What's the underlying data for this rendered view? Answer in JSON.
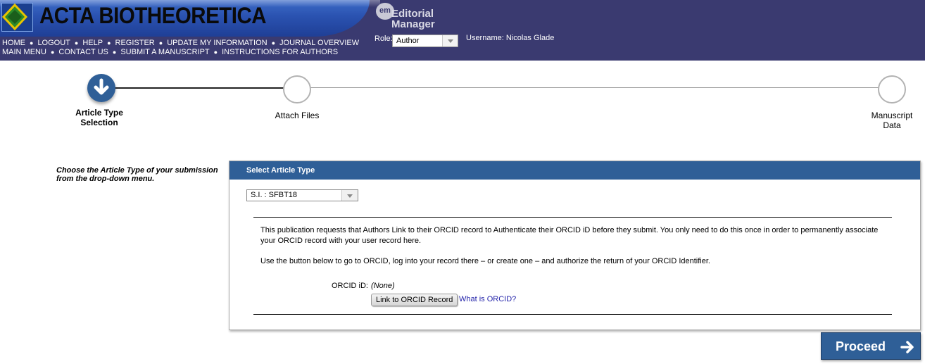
{
  "header": {
    "journal_title": "ACTA BIOTHEORETICA",
    "em_badge": "em",
    "em_line1": "Editorial",
    "em_line2": "Manager",
    "nav_row1": [
      "HOME",
      "LOGOUT",
      "HELP",
      "REGISTER",
      "UPDATE MY INFORMATION",
      "JOURNAL OVERVIEW"
    ],
    "nav_row2": [
      "MAIN MENU",
      "CONTACT US",
      "SUBMIT A MANUSCRIPT",
      "INSTRUCTIONS FOR AUTHORS"
    ],
    "role_label": "Role:",
    "role_value": "Author",
    "username": "Username: Nicolas Glade"
  },
  "stepper": {
    "steps": [
      {
        "line1": "Article Type",
        "line2": "Selection",
        "state": "active"
      },
      {
        "line1": "Attach Files",
        "line2": "",
        "state": "pending"
      },
      {
        "line1": "Manuscript",
        "line2": "Data",
        "state": "pending"
      }
    ]
  },
  "instructions": "Choose the Article Type of your submission from the drop-down menu.",
  "panel": {
    "title": "Select Article Type",
    "article_type_value": "S.I. : SFBT18",
    "orcid_para1": "This publication requests that Authors Link to their ORCID record to Authenticate their ORCID iD before they submit. You only need to do this once in order to permanently associate your ORCID record with your user record here.",
    "orcid_para2": "Use the button below to go to ORCID, log into your record there – or create one – and authorize the return of your ORCID Identifier.",
    "orcid_id_label": "ORCID iD:",
    "orcid_id_value": "(None)",
    "link_button": "Link to ORCID Record",
    "what_is_link": "What is ORCID?"
  },
  "proceed_label": "Proceed",
  "colors": {
    "header_bg": "#3a3a70",
    "accent_blue": "#2f5f97"
  }
}
